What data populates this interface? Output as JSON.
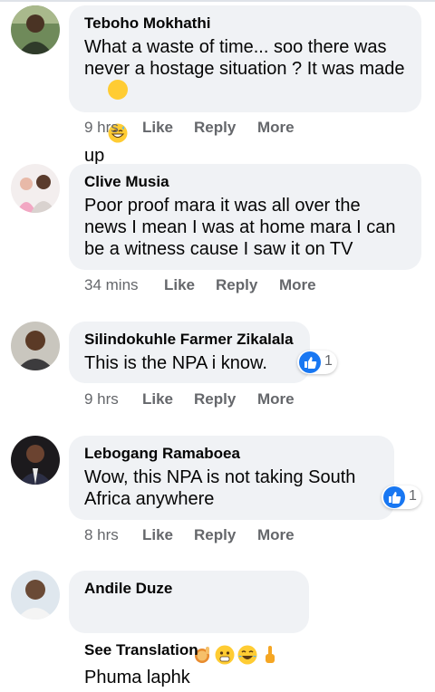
{
  "comments": [
    {
      "author": "Teboho Mokhathi",
      "text": "What a waste of time... soo there was never a hostage situation ? It was made up",
      "emoji": "grinning-sweat-emoji",
      "time": "9 hrs",
      "like": "Like",
      "reply": "Reply",
      "more": "More"
    },
    {
      "author": "Clive Musia",
      "text": "Poor proof mara it was all over the news I mean I was at home mara I can be a witness cause I saw it on TV",
      "time": "34 mins",
      "like": "Like",
      "reply": "Reply",
      "more": "More"
    },
    {
      "author": "Silindokuhle Farmer Zikalala",
      "text": "This is the NPA i know.",
      "reaction_count": "1",
      "time": "9 hrs",
      "like": "Like",
      "reply": "Reply",
      "more": "More"
    },
    {
      "author": "Lebogang Ramaboea",
      "text": "Wow, this NPA is not taking South Africa anywhere",
      "reaction_count": "1",
      "time": "8 hrs",
      "like": "Like",
      "reply": "Reply",
      "more": "More"
    },
    {
      "author": "Andile Duze",
      "text": "Phuma laphk",
      "emojis": [
        "raising-hand-emoji",
        "astonished-emoji",
        "tears-of-joy-emoji",
        "pointing-up-emoji"
      ],
      "see_translation": "See Translation"
    }
  ],
  "colors": {
    "bubble": "#f0f2f5",
    "meta": "#65676b",
    "like_blue": "#1877f2"
  }
}
